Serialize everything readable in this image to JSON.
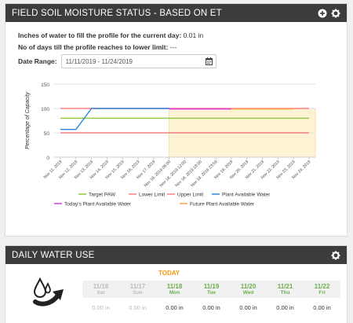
{
  "soil_panel": {
    "title": "FIELD SOIL MOISTURE STATUS - BASED ON ET",
    "water_fill_label": "Inches of water to fill the profile for the current day:",
    "water_fill_value": "0.01 in",
    "days_label": "No of days till the profile reaches to lower limit:",
    "days_value": "---",
    "date_range_label": "Date Range:",
    "date_range_value": "11/11/2019 - 11/24/2019"
  },
  "chart_data": {
    "type": "line",
    "ylabel": "Percentage of Capacity",
    "ylim": [
      0,
      150
    ],
    "yticks": [
      0,
      50,
      100,
      150
    ],
    "categories": [
      "Nov 11, 2019",
      "Nov 12, 2019",
      "Nov 13, 2019",
      "Nov 14, 2019",
      "Nov 15, 2019",
      "Nov 16, 2019",
      "Nov 17, 2019",
      "Nov 18, 2019 06:00",
      "Nov 18, 2019 12:00",
      "Nov 18, 2019 18:00",
      "Nov 18, 2019 23:59",
      "Nov 19, 2019",
      "Nov 20, 2019",
      "Nov 21, 2019",
      "Nov 22, 2019",
      "Nov 23, 2019",
      "Nov 24, 2019"
    ],
    "today_region_start_index": 7,
    "series": [
      {
        "name": "Target PAW",
        "color": "#8dc63f",
        "x_range": [
          0,
          16
        ],
        "values": [
          80,
          80,
          80,
          80,
          80,
          80,
          80,
          80,
          80,
          80,
          80,
          80,
          80,
          80,
          80,
          80,
          80
        ]
      },
      {
        "name": "Lower Limit",
        "color": "#f08080",
        "x_range": [
          0,
          16
        ],
        "values": [
          50,
          50,
          50,
          50,
          50,
          50,
          50,
          50,
          50,
          50,
          50,
          50,
          50,
          50,
          50,
          50,
          50
        ]
      },
      {
        "name": "Upper Limit",
        "color": "#ff8080",
        "x_range": [
          0,
          16
        ],
        "values": [
          100,
          100,
          100,
          100,
          100,
          100,
          100,
          100,
          100,
          100,
          100,
          100,
          100,
          100,
          100,
          100,
          100
        ]
      },
      {
        "name": "Plant Available Water",
        "color": "#2e86de",
        "x_range": [
          0,
          7
        ],
        "values": [
          57,
          57,
          100,
          100,
          100,
          100,
          100,
          100
        ]
      },
      {
        "name": "Today's Plant Available Water",
        "color": "#d63ce0",
        "x_range": [
          7,
          11
        ],
        "values": [
          99,
          99,
          99,
          99,
          99
        ]
      },
      {
        "name": "Future Plant Available Water",
        "color": "#f5a742",
        "x_range": [
          11,
          15
        ],
        "values": [
          99,
          99,
          99,
          99,
          99
        ]
      }
    ],
    "legend": [
      "Target PAW",
      "Lower Limit",
      "Upper Limit",
      "Plant Available Water",
      "Today's Plant Available Water",
      "Future Plant Available Water"
    ],
    "legend_position": "bottom",
    "grid": true
  },
  "water_panel": {
    "title": "DAILY WATER USE",
    "today_label": "TODAY",
    "days": [
      {
        "date": "11/16",
        "day": "Sat",
        "value": "0.00 in",
        "style": "past"
      },
      {
        "date": "11/17",
        "day": "Sun",
        "value": "0.00 in",
        "style": "past"
      },
      {
        "date": "11/18",
        "day": "Mon",
        "value": "0.00 in",
        "style": "future"
      },
      {
        "date": "11/19",
        "day": "Tue",
        "value": "0.00 in",
        "style": "future"
      },
      {
        "date": "11/20",
        "day": "Wed",
        "value": "0.00 in",
        "style": "future"
      },
      {
        "date": "11/21",
        "day": "Thu",
        "value": "0.00 in",
        "style": "future"
      },
      {
        "date": "11/22",
        "day": "Fri",
        "value": "0.00 in",
        "style": "future"
      }
    ]
  },
  "colors": {
    "header_bg": "#3c3c3c",
    "today_orange": "#f39c12",
    "future_green": "#6ab04c",
    "past_gray": "#bbbbbb",
    "today_region": "#fdf3d4"
  },
  "icons": {
    "add": "plus-circle-icon",
    "settings": "gear-icon",
    "calendar": "calendar-icon",
    "water": "water-drops-arrow-icon"
  }
}
